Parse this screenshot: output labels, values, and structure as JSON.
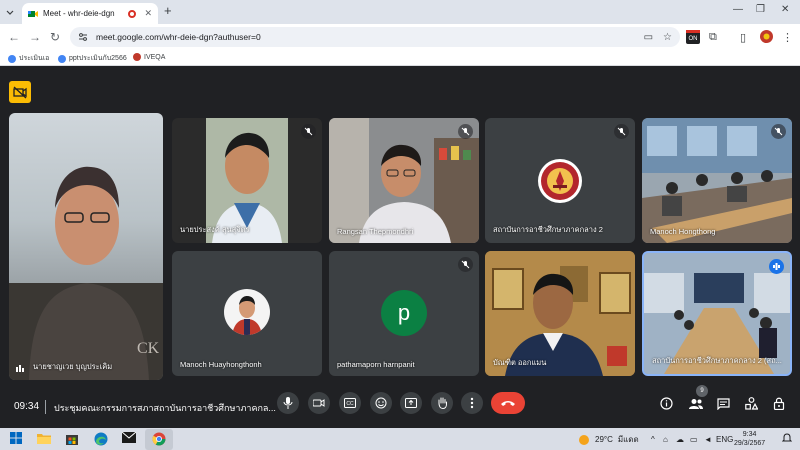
{
  "browser": {
    "tab_title": "Meet - whr-deie-dgn",
    "url": "meet.google.com/whr-deie-dgn?authuser=0",
    "bookmarks": [
      {
        "label": "ประเมินเอ",
        "color": "#4285f4"
      },
      {
        "label": "pptประเมินกับ2566",
        "color": "#4285f4"
      },
      {
        "label": "IVEQA",
        "color": "#c0392b"
      }
    ]
  },
  "meet": {
    "time": "09:34",
    "meeting_title": "ประชุมคณะกรรมการสภาสถาบันการอาชีวศึกษาภาคกล...",
    "participants_count": "9",
    "participants": [
      {
        "name": "นายชาญเวย บุญประเคิม",
        "kind": "video"
      },
      {
        "name": "นายประสงค์ สุนสุจิตร",
        "kind": "video"
      },
      {
        "name": "Rangsan Thepmondhri",
        "kind": "video"
      },
      {
        "name": "สถาบันการอาชีวศึกษาภาคกลาง 2",
        "kind": "logo"
      },
      {
        "name": "Manoch Hongthong",
        "kind": "video"
      },
      {
        "name": "Manoch Huayhongthonh",
        "kind": "avatar-photo"
      },
      {
        "name": "pathamaporn harnpanit",
        "kind": "avatar-letter",
        "letter": "p",
        "color": "#0b8043"
      },
      {
        "name": "บัณฑิต ออกแมน",
        "kind": "video"
      },
      {
        "name": "สถาบันการอาชีวศึกษาภาคกลาง 2 (สถ...",
        "kind": "video"
      }
    ]
  },
  "taskbar": {
    "temperature": "29°C",
    "weather_text": "มีแดด",
    "language": "ENG",
    "clock_time": "9:34",
    "clock_date": "29/3/2567"
  },
  "colors": {
    "accent": "#1a73e8",
    "end_call": "#ea4335",
    "meet_bg": "#202124"
  }
}
